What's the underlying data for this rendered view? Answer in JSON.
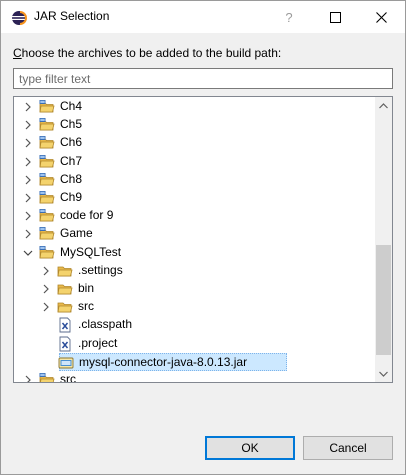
{
  "window": {
    "title": "JAR Selection",
    "help_glyph": "?"
  },
  "prompt": {
    "text_before": "",
    "mnemonic": "C",
    "text_after": "hoose the archives to be added to the build path:"
  },
  "filter": {
    "value": "",
    "placeholder": "type filter text"
  },
  "tree": {
    "items": [
      {
        "label": "Ch4",
        "icon": "project-folder-icon",
        "twisty": "collapsed"
      },
      {
        "label": "Ch5",
        "icon": "project-folder-icon",
        "twisty": "collapsed"
      },
      {
        "label": "Ch6",
        "icon": "project-folder-icon",
        "twisty": "collapsed"
      },
      {
        "label": "Ch7",
        "icon": "project-folder-icon",
        "twisty": "collapsed"
      },
      {
        "label": "Ch8",
        "icon": "project-folder-icon",
        "twisty": "collapsed"
      },
      {
        "label": "Ch9",
        "icon": "project-folder-icon",
        "twisty": "collapsed"
      },
      {
        "label": "code for 9",
        "icon": "project-folder-icon",
        "twisty": "collapsed"
      },
      {
        "label": "Game",
        "icon": "project-folder-icon",
        "twisty": "collapsed"
      },
      {
        "label": "MySQLTest",
        "icon": "project-folder-icon",
        "twisty": "expanded"
      },
      {
        "label": ".settings",
        "icon": "folder-icon",
        "twisty": "collapsed"
      },
      {
        "label": "bin",
        "icon": "folder-icon",
        "twisty": "collapsed"
      },
      {
        "label": "src",
        "icon": "folder-icon",
        "twisty": "collapsed"
      },
      {
        "label": ".classpath",
        "icon": "xml-file-icon",
        "twisty": "none"
      },
      {
        "label": ".project",
        "icon": "xml-file-icon",
        "twisty": "none"
      },
      {
        "label": "mysql-connector-java-8.0.13.jar",
        "icon": "jar-file-icon",
        "twisty": "none",
        "selected": true
      },
      {
        "label": "src",
        "icon": "project-folder-icon",
        "twisty": "collapsed"
      }
    ]
  },
  "buttons": {
    "ok_label": "OK",
    "cancel_label": "Cancel"
  },
  "colors": {
    "selection": "#cce8ff",
    "default_button_border": "#0078d7",
    "folder": "#e8b84a"
  }
}
